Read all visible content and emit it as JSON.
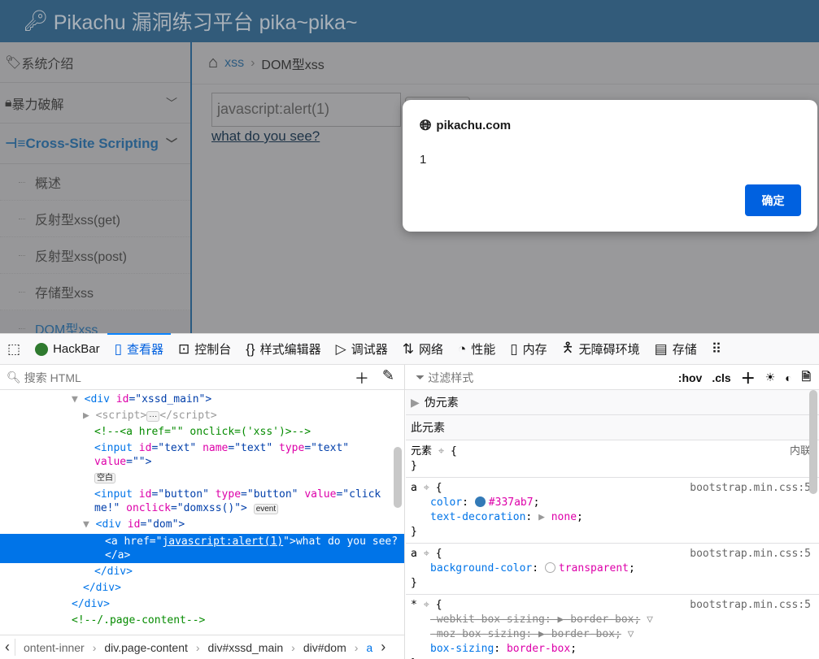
{
  "header": {
    "title": "Pikachu 漏洞练习平台 pika~pika~"
  },
  "sidebar": {
    "items": [
      {
        "label": "系统介绍"
      },
      {
        "label": "暴力破解"
      },
      {
        "label": "Cross-Site Scripting"
      }
    ],
    "subitems": [
      "概述",
      "反射型xss(get)",
      "反射型xss(post)",
      "存储型xss",
      "DOM型xss"
    ]
  },
  "breadcrumb": {
    "link": "xss",
    "current": "DOM型xss"
  },
  "main": {
    "input_value": "javascript:alert(1)",
    "link": "what do you see?"
  },
  "dialog": {
    "host": "pikachu.com",
    "message": "1",
    "ok": "确定"
  },
  "devtools": {
    "tabs": [
      "HackBar",
      "查看器",
      "控制台",
      "样式编辑器",
      "调试器",
      "网络",
      "性能",
      "内存",
      "无障碍环境",
      "存储"
    ],
    "search_placeholder": "搜索 HTML",
    "filter_placeholder": "过滤样式",
    "hov": ":hov",
    "cls": ".cls",
    "markup": {
      "l1": [
        "<div ",
        "id",
        "=\"xssd_main\">"
      ],
      "l2": [
        "<script>",
        "</script>"
      ],
      "l3": "<!--<a href=\"\" onclick=('xss')>-->",
      "l4": [
        "<input ",
        "id",
        "=\"text\" ",
        "name",
        "=\"text\" ",
        "type",
        "=\"text\""
      ],
      "l5": [
        "value",
        "=\"\">"
      ],
      "badge_whitespace": "空白",
      "l6": [
        "<input ",
        "id",
        "=\"button\" ",
        "type",
        "=\"button\" ",
        "value",
        "=\"click"
      ],
      "l7": [
        "me!\" ",
        "onclick",
        "=\"domxss()\">"
      ],
      "badge_event": "event",
      "l8": [
        "<div ",
        "id",
        "=\"dom\">"
      ],
      "l9": [
        "<a href=\"",
        "javascript:alert(1)",
        "\">what do you see?"
      ],
      "l10": "</a>",
      "l11": "</div>",
      "l12": "</div>",
      "l13": "</div>",
      "l14": "<!--/.page-content-->"
    },
    "breadcrumbs": [
      "ontent-inner",
      "div.page-content",
      "div#xssd_main",
      "div#dom",
      "a"
    ],
    "rules": {
      "pseudo": "伪元素",
      "this": "此元素",
      "element": "元素",
      "inline": "内联",
      "src": "bootstrap.min.css:5",
      "r1": {
        "sel": "a",
        "p1": "color",
        "v1": "#337ab7",
        "p2": "text-decoration",
        "v2": "none"
      },
      "r2": {
        "sel": "a",
        "p1": "background-color",
        "v1": "transparent"
      },
      "r3": {
        "sel": "*",
        "p1": "-webkit-box-sizing",
        "v1": "border-box",
        "p2": "-moz-box-sizing",
        "v2": "border-box",
        "p3": "box-sizing",
        "v3": "border-box"
      }
    }
  }
}
